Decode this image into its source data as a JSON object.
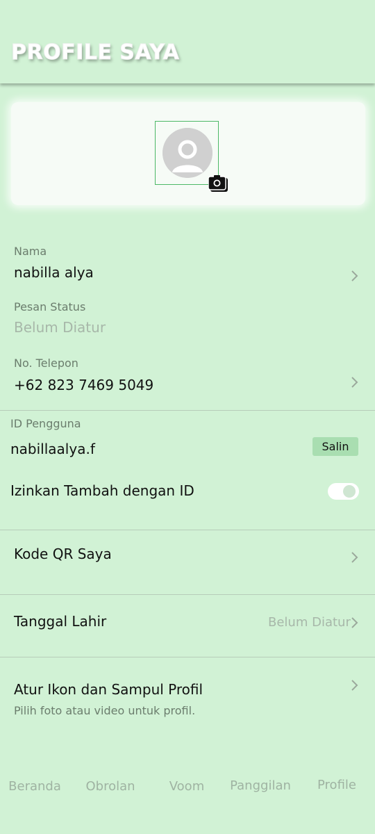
{
  "header": {
    "title": "PROFILE SAYA"
  },
  "profile": {
    "avatar_icon": "person-placeholder-icon",
    "camera_icon": "camera-icon"
  },
  "fields": {
    "name_label": "Nama",
    "name_value": "nabilla alya",
    "status_label": "Pesan Status",
    "status_value": "Belum Diatur",
    "phone_label": "No. Telepon",
    "phone_value": "+62 823 7469 5049",
    "userid_label": "ID Pengguna",
    "userid_value": "nabillaalya.f",
    "copy_label": "Salin",
    "allow_add_label": "Izinkan Tambah dengan ID",
    "allow_add_enabled": true
  },
  "sections": {
    "qr_label": "Kode QR Saya",
    "birthday_label": "Tanggal Lahir",
    "birthday_value": "Belum Diatur",
    "icon_cover_label": "Atur Ikon dan Sampul Profil",
    "icon_cover_sub": "Pilih foto atau video untuk profil."
  },
  "bottom_nav": {
    "home": "Beranda",
    "chat": "Obrolan",
    "voom": "Voom",
    "calls": "Panggilan",
    "profile": "Profile"
  },
  "colors": {
    "background": "#d1f2d5",
    "card": "#f6fbf6",
    "accent": "#4cb866",
    "badge": "#a9deb1"
  }
}
